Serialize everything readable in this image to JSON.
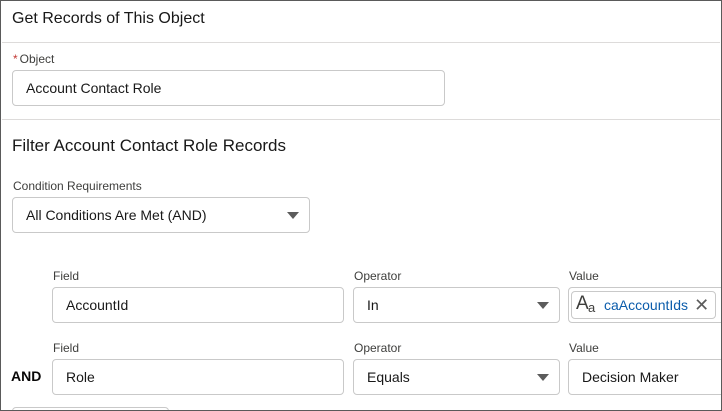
{
  "header": {
    "title": "Get Records of This Object"
  },
  "object_section": {
    "required_marker": "*",
    "label": "Object",
    "value": "Account Contact Role"
  },
  "filter_section": {
    "title": "Filter Account Contact Role Records",
    "condition_label": "Condition Requirements",
    "condition_value": "All Conditions Are Met (AND)"
  },
  "conditions": [
    {
      "field_label": "Field",
      "field_value": "AccountId",
      "operator_label": "Operator",
      "operator_value": "In",
      "value_label": "Value",
      "value_text": "caAccountIds"
    },
    {
      "connector": "AND",
      "field_label": "Field",
      "field_value": "Role",
      "operator_label": "Operator",
      "operator_value": "Equals",
      "value_label": "Value",
      "value_text": "Decision Maker"
    }
  ],
  "icons": {
    "resource": "text-resource-icon",
    "remove": "close-icon",
    "dropdown": "chevron-down-icon"
  }
}
